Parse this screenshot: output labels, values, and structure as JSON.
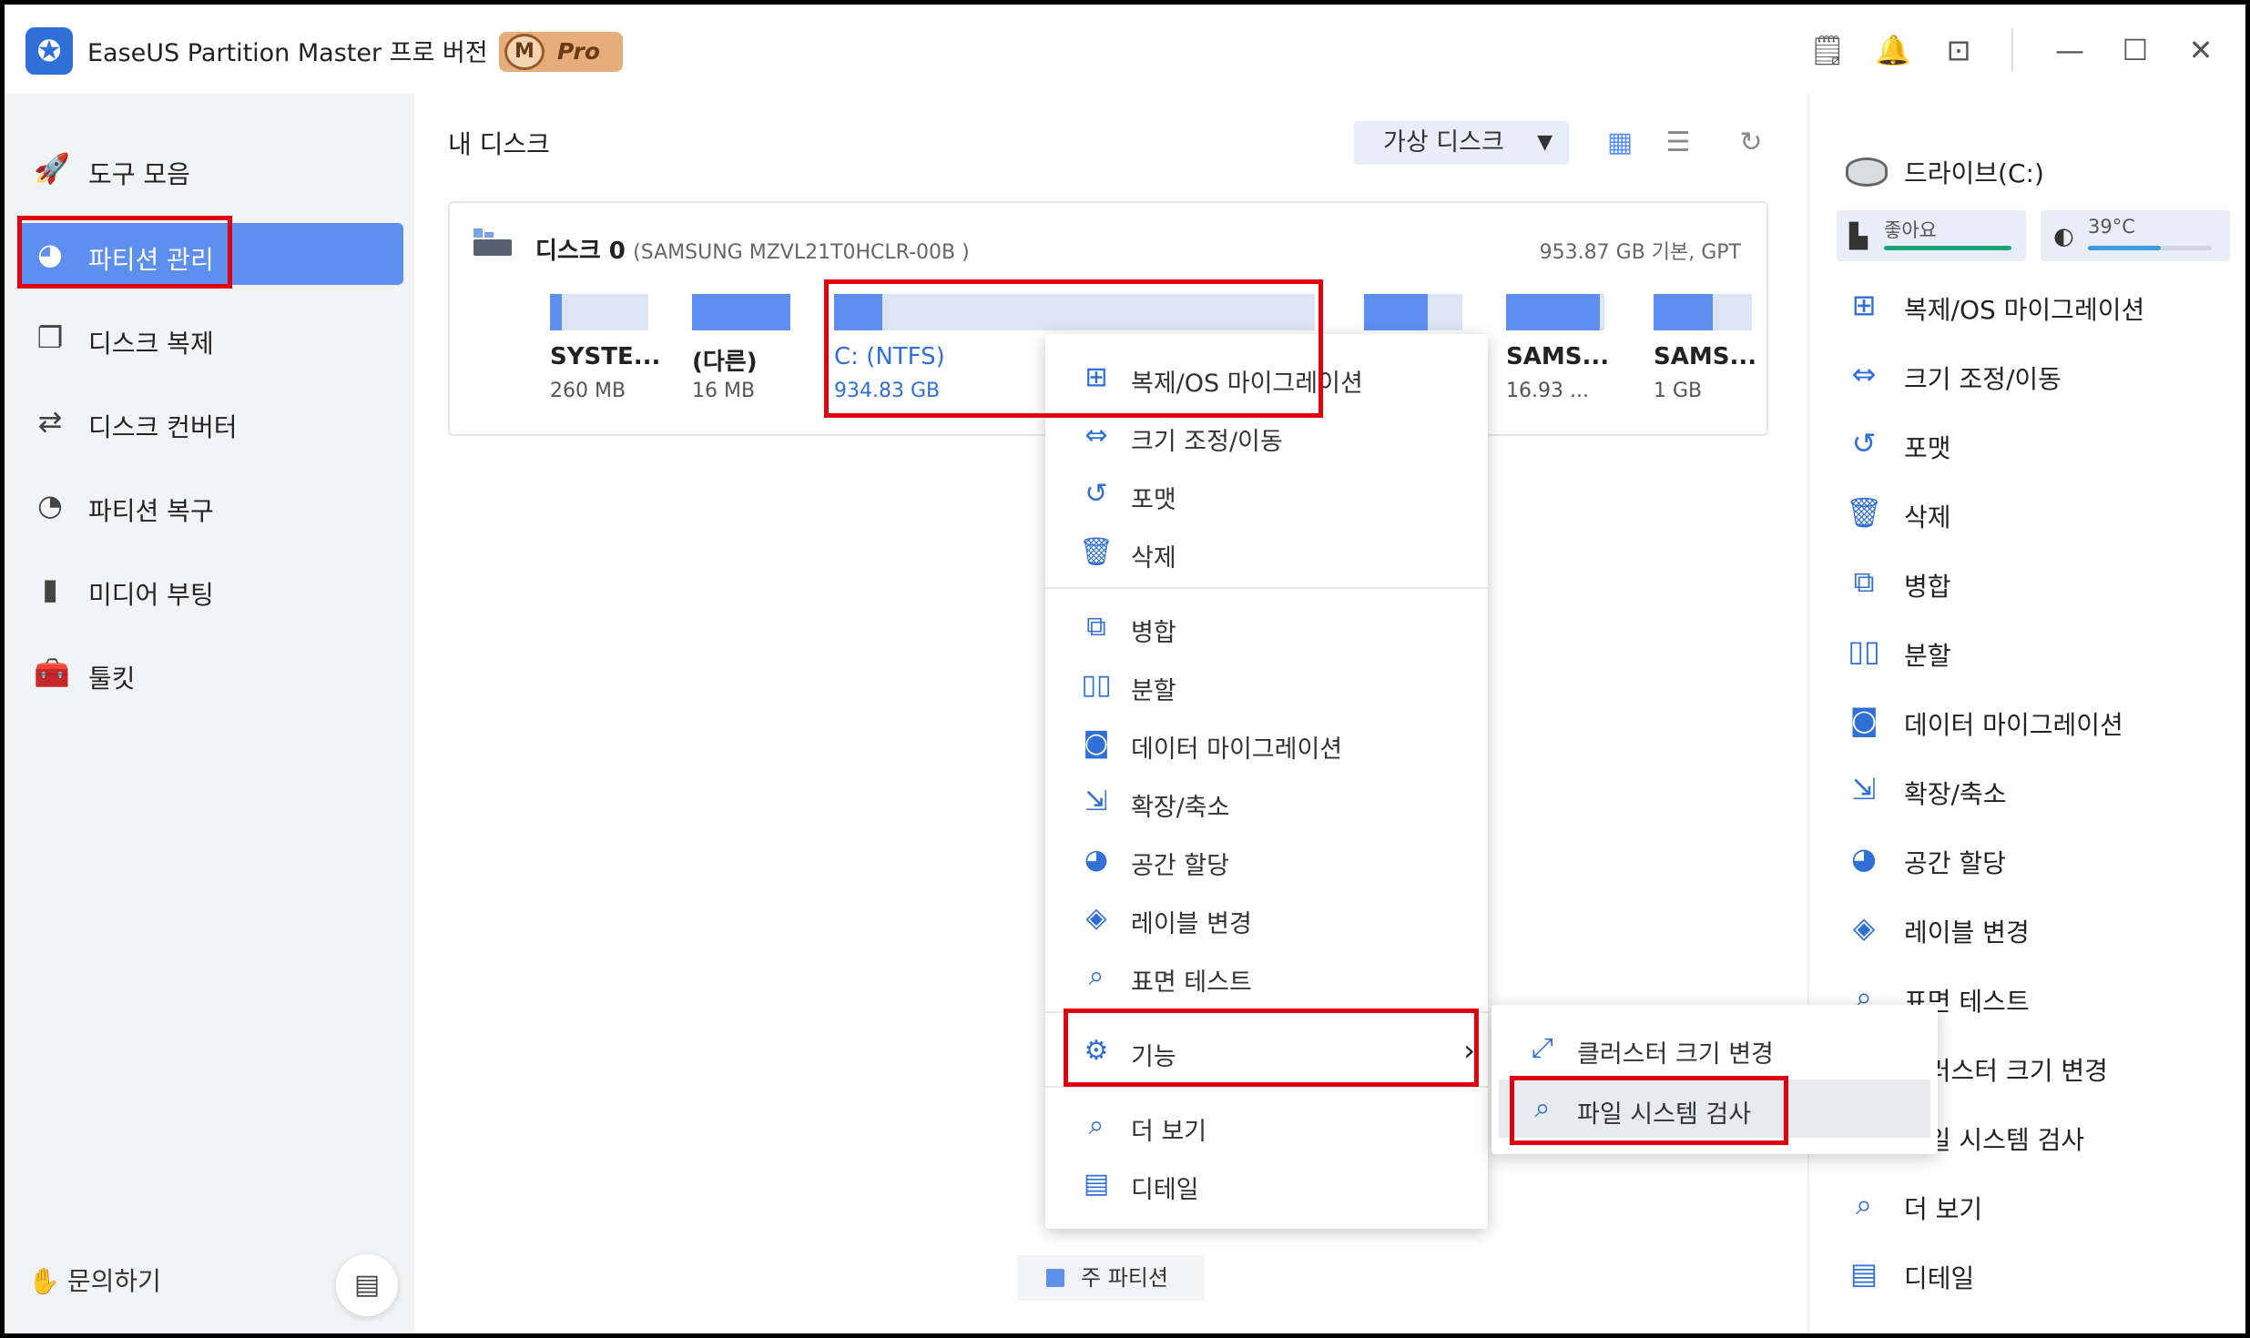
{
  "titlebar": {
    "app_title": "EaseUS Partition Master 프로 버전",
    "pro_badge_m": "M",
    "pro_badge": "Pro",
    "icons": [
      "notes-icon",
      "bell-icon",
      "dropdown-icon",
      "minimize-icon",
      "maximize-icon",
      "close-icon"
    ]
  },
  "sidebar": {
    "items": [
      {
        "label": "도구 모음",
        "icon": "rocket-icon"
      },
      {
        "label": "파티션 관리",
        "icon": "pie-chart-icon"
      },
      {
        "label": "디스크 복제",
        "icon": "copy-icon"
      },
      {
        "label": "디스크 컨버터",
        "icon": "convert-icon"
      },
      {
        "label": "파티션 복구",
        "icon": "recovery-icon"
      },
      {
        "label": "미디어 부팅",
        "icon": "usb-icon"
      },
      {
        "label": "툴킷",
        "icon": "toolkit-icon"
      }
    ],
    "contact": "문의하기"
  },
  "main": {
    "title": "내 디스크",
    "virtual_disk_button": "가상 디스크",
    "disk": {
      "name": "디스크 0",
      "model": "(SAMSUNG MZVL21T0HCLR-00B )",
      "info": "953.87 GB 기본, GPT",
      "partitions": [
        {
          "name": "SYSTE...",
          "size": "260 MB",
          "used": 0.12
        },
        {
          "name": "(다른)",
          "size": "16 MB",
          "used": 1.0
        },
        {
          "name": "C: (NTFS)",
          "size": "934.83 GB",
          "used": 0.1
        },
        {
          "name": "",
          "size": "",
          "used": 0.65
        },
        {
          "name": "SAMS...",
          "size": "16.93 ...",
          "used": 0.95
        },
        {
          "name": "SAMS...",
          "size": "1 GB",
          "used": 0.6
        }
      ]
    },
    "legend": "주 파티션"
  },
  "context_menu": {
    "items": [
      {
        "label": "복제/OS 마이그레이션",
        "icon": "windows-icon"
      },
      {
        "label": "크기 조정/이동",
        "icon": "resize-icon"
      },
      {
        "label": "포맷",
        "icon": "format-icon"
      },
      {
        "label": "삭제",
        "icon": "trash-icon"
      },
      {
        "label": "병합",
        "icon": "merge-icon"
      },
      {
        "label": "분할",
        "icon": "split-icon"
      },
      {
        "label": "데이터 마이그레이션",
        "icon": "data-migration-icon"
      },
      {
        "label": "확장/축소",
        "icon": "extend-icon"
      },
      {
        "label": "공간 할당",
        "icon": "allocate-icon"
      },
      {
        "label": "레이블 변경",
        "icon": "label-icon"
      },
      {
        "label": "표면 테스트",
        "icon": "surface-test-icon"
      },
      {
        "label": "기능",
        "icon": "settings-sliders-icon"
      },
      {
        "label": "더 보기",
        "icon": "explore-icon"
      },
      {
        "label": "디테일",
        "icon": "details-icon"
      }
    ]
  },
  "submenu": {
    "items": [
      {
        "label": "클러스터 크기 변경",
        "icon": "cluster-icon"
      },
      {
        "label": "파일 시스템 검사",
        "icon": "file-check-icon"
      }
    ]
  },
  "right_panel": {
    "drive_title": "드라이브(C:)",
    "health": "좋아요",
    "temperature": "39°C",
    "actions": [
      {
        "label": "복제/OS 마이그레이션"
      },
      {
        "label": "크기 조정/이동"
      },
      {
        "label": "포맷"
      },
      {
        "label": "삭제"
      },
      {
        "label": "병합"
      },
      {
        "label": "분할"
      },
      {
        "label": "데이터 마이그레이션"
      },
      {
        "label": "확장/축소"
      },
      {
        "label": "공간 할당"
      },
      {
        "label": "레이블 변경"
      },
      {
        "label": "표면 테스트"
      },
      {
        "label": "클러스터 크기 변경"
      },
      {
        "label": "파일 시스템 검사"
      },
      {
        "label": "더 보기"
      },
      {
        "label": "디테일"
      }
    ]
  },
  "colors": {
    "accent": "#5c8ff0",
    "primary_icon": "#2f6fd6",
    "highlight_box": "#e0000f",
    "health_green": "#1aa37a",
    "temp_blue": "#3a9be0"
  }
}
